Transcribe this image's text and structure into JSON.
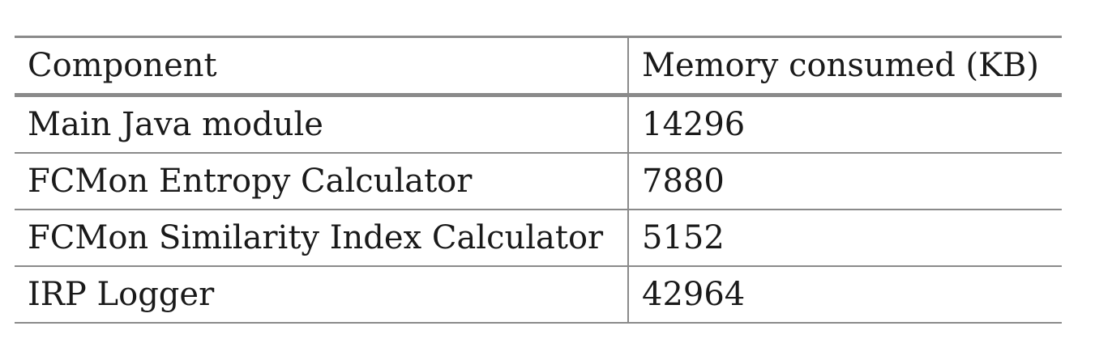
{
  "table": {
    "headers": [
      "Component",
      "Memory consumed (KB)"
    ],
    "rows": [
      [
        "Main Java module",
        "14296"
      ],
      [
        "FCMon Entropy Calculator",
        "7880"
      ],
      [
        "FCMon Similarity Index Calculator",
        "5152"
      ],
      [
        "IRP Logger",
        "42964"
      ]
    ]
  },
  "chart_data": {
    "type": "table",
    "columns": [
      "Component",
      "Memory consumed (KB)"
    ],
    "rows": [
      {
        "Component": "Main Java module",
        "Memory consumed (KB)": 14296
      },
      {
        "Component": "FCMon Entropy Calculator",
        "Memory consumed (KB)": 7880
      },
      {
        "Component": "FCMon Similarity Index Calculator",
        "Memory consumed (KB)": 5152
      },
      {
        "Component": "IRP Logger",
        "Memory consumed (KB)": 42964
      }
    ]
  }
}
